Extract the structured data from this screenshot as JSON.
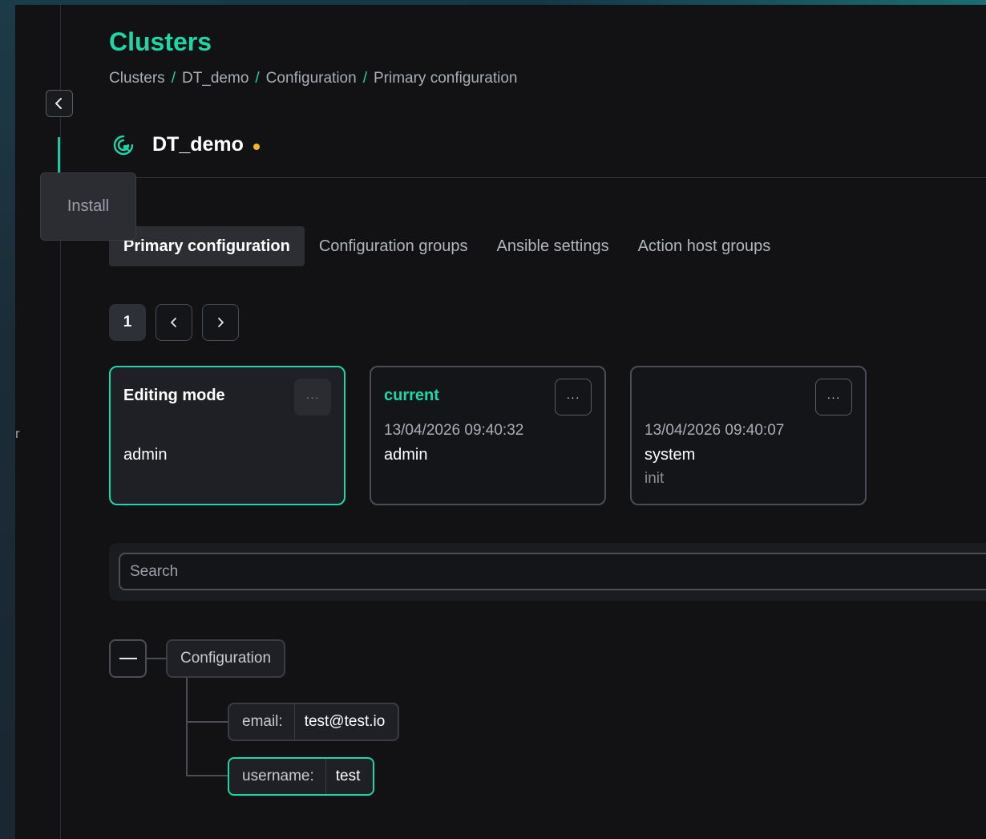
{
  "page": {
    "title": "Clusters",
    "breadcrumb": [
      "Clusters",
      "DT_demo",
      "Configuration",
      "Primary configuration"
    ]
  },
  "sidebar": {
    "collapse_icon": "chevron-left-icon",
    "tooltip": "Install",
    "stray_label": "r"
  },
  "cluster": {
    "name": "DT_demo",
    "status_color": "#f5b81f",
    "icon": "cluster-spinner-icon"
  },
  "tabs": [
    {
      "label": "Primary configuration",
      "active": true
    },
    {
      "label": "Configuration groups",
      "active": false
    },
    {
      "label": "Ansible settings",
      "active": false
    },
    {
      "label": "Action host groups",
      "active": false
    }
  ],
  "pager": {
    "current_page": "1"
  },
  "cards": [
    {
      "title": "Editing mode",
      "date": "",
      "user": "admin",
      "description": "",
      "menu": "···"
    },
    {
      "title": "current",
      "date": "13/04/2026 09:40:32",
      "user": "admin",
      "description": "",
      "menu": "···"
    },
    {
      "title": "",
      "date": "13/04/2026 09:40:07",
      "user": "system",
      "description": "init",
      "menu": "···"
    }
  ],
  "search": {
    "placeholder": "Search",
    "value": ""
  },
  "tree": {
    "root": "Configuration",
    "fields": [
      {
        "key": "email:",
        "value": "test@test.io"
      },
      {
        "key": "username:",
        "value": "test"
      }
    ]
  },
  "colors": {
    "accent": "#1ed6a6",
    "background": "#121215",
    "status_dot": "#f5b81f"
  }
}
